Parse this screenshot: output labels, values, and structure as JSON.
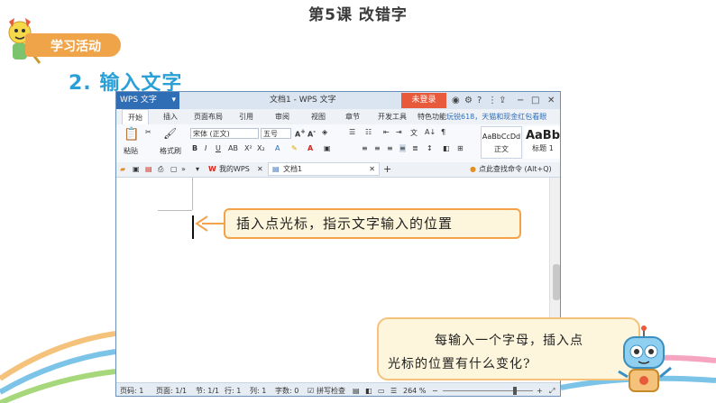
{
  "slide": {
    "lesson_title": "第5课  改错字",
    "activity_badge": "学习活动",
    "section_title": "2. 输入文字"
  },
  "window": {
    "app_menu": "WPS 文字",
    "doc_title": "文档1 - WPS 文字",
    "login_button": "未登录",
    "ribbon_tabs": [
      "开始",
      "插入",
      "页面布局",
      "引用",
      "审阅",
      "视图",
      "章节",
      "开发工具",
      "特色功能"
    ],
    "promo_text": "玩锐618，天猫和现金红包看眼",
    "toolbar": {
      "paste": "粘贴",
      "format_painter": "格式刷",
      "font_name": "宋体 (正文)",
      "font_size": "五号",
      "style_normal_preview": "AaBbCcDd",
      "style_normal": "正文",
      "style_h1_preview": "AaBb",
      "style_h1": "标题 1"
    },
    "quick_tabs": {
      "home_tab": "我的WPS",
      "doc_tab": "文档1",
      "search_hint": "点此查找命令 (Alt+Q)"
    },
    "status": {
      "col": "页码: 1",
      "page": "页面: 1/1",
      "section": "节: 1/1",
      "row": "行: 1",
      "column": "列: 1",
      "words": "字数: 0",
      "spell": "拼写检查",
      "zoom": "264 %"
    }
  },
  "callout": "插入点光标，指示文字输入的位置",
  "bubble": {
    "line1": "每输入一个字母，插入点",
    "line2": "光标的位置有什么变化?"
  },
  "colors": {
    "accent_blue": "#2aa0d8",
    "badge_orange": "#f0a44a",
    "login_red": "#e85a3c"
  }
}
